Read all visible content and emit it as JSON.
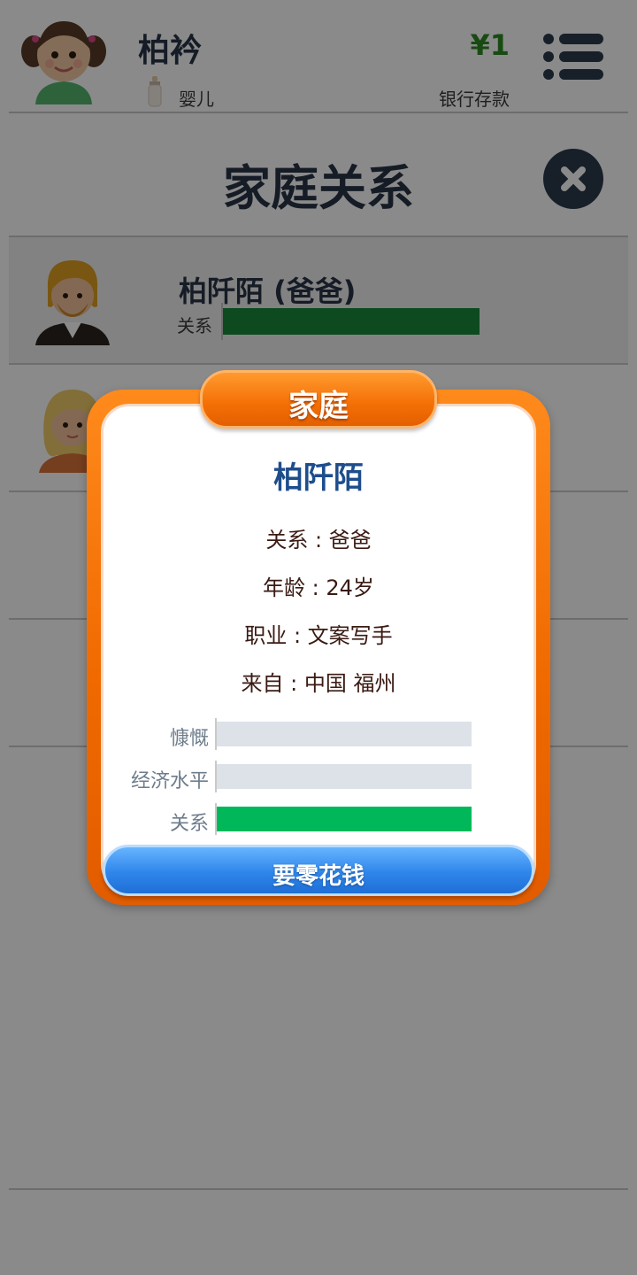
{
  "header": {
    "player_name": "柏衿",
    "life_stage": "婴儿",
    "money": "¥1",
    "money_label": "银行存款"
  },
  "page": {
    "title": "家庭关系"
  },
  "family_list": [
    {
      "name": "柏阡陌 (爸爸)",
      "relation_label": "关系",
      "relation_level": 1.0
    },
    {
      "name": "",
      "relation_label": "",
      "relation_level": null
    }
  ],
  "modal": {
    "tab_title": "家庭",
    "person_name": "柏阡陌",
    "relation_line": "关系 : 爸爸",
    "age_line": "年龄 : 24岁",
    "job_line": "职业 : 文案写手",
    "from_line": "来自 : 中国 福州",
    "stats": [
      {
        "label": "慷慨",
        "level": 0.0
      },
      {
        "label": "经济水平",
        "level": 0.0
      },
      {
        "label": "关系",
        "level": 1.0
      }
    ],
    "action_label": "要零花钱"
  },
  "colors": {
    "money": "#2e8b22",
    "relation_bar": "#1a8a3a",
    "stat_fill": "#00b85a",
    "modal_orange": "#f06a00",
    "action_blue": "#2f86ea",
    "title_navy": "#2a3547",
    "name_blue": "#1e4d8c"
  },
  "icons": {
    "player_avatar": "girl-avatar-icon",
    "life_stage": "baby-bottle-icon",
    "menu": "menu-list-icon",
    "close": "close-icon",
    "father_avatar": "father-avatar-icon",
    "mother_avatar": "mother-avatar-icon"
  }
}
